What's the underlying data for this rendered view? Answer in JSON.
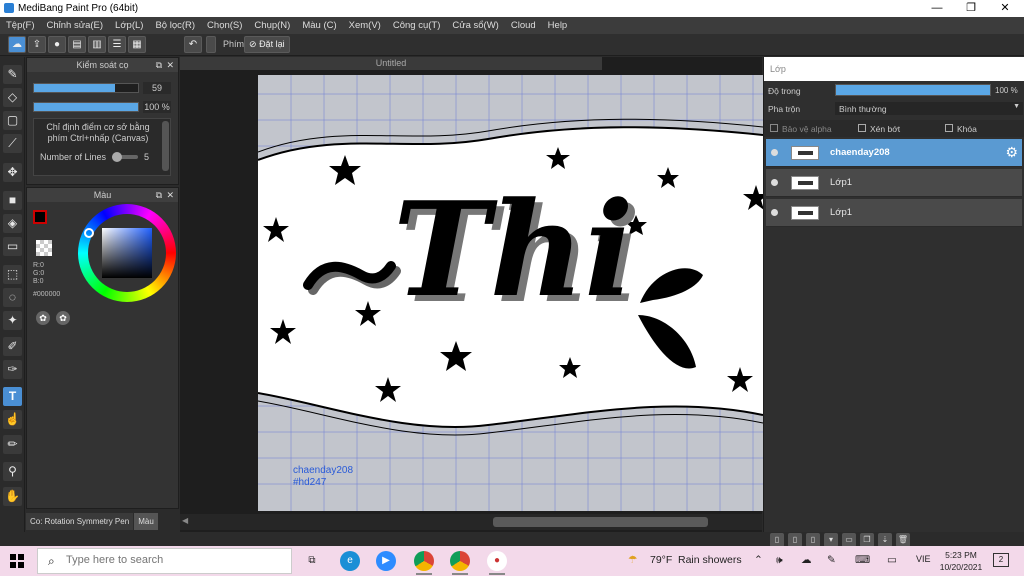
{
  "window": {
    "title": "MediBang Paint Pro (64bit)",
    "min": "—",
    "max": "❐",
    "close": "✕"
  },
  "menu": [
    "Tệp(F)",
    "Chỉnh sửa(E)",
    "Lớp(L)",
    "Bộ lọc(R)",
    "Chọn(S)",
    "Chụp(N)",
    "Màu (C)",
    "Xem(V)",
    "Công cụ(T)",
    "Cửa sổ(W)",
    "Cloud",
    "Help"
  ],
  "toolbar": {
    "phim_label": "Phím",
    "reset_label": "Đặt lại"
  },
  "brush_panel": {
    "title": "Kiểm soát cọ",
    "size_value": "59",
    "size_fraction": 0.78,
    "opacity_value": "100 %",
    "opacity_fraction": 1.0,
    "hint": "Chỉ định điểm cơ sở bằng phím Ctrl+nhấp (Canvas)",
    "lines_label": "Number of Lines",
    "lines_value": "5"
  },
  "color_panel": {
    "title": "Màu",
    "r": "R:0",
    "g": "G:0",
    "b": "B:0",
    "hex": "#000000",
    "primary": "#000000",
    "secondary": "#ffffff"
  },
  "canvas": {
    "tab": "Untitled",
    "wave_text": "Thi",
    "watermark_line1": "chaenday208",
    "watermark_line2": "#hd247"
  },
  "status": {
    "tool": "Co: Rotation Symmetry Pen",
    "tab": "Màu"
  },
  "layers_panel": {
    "title": "Lớp",
    "opacity_label": "Độ trong",
    "opacity_value": "100 %",
    "opacity_fraction": 1.0,
    "blend_label": "Pha trộn",
    "blend_value": "Bình thường",
    "protect_alpha": "Bảo vệ alpha",
    "clipping": "Xén bớt",
    "lock": "Khóa",
    "items": [
      {
        "name": "chaenday208",
        "selected": true
      },
      {
        "name": "Lớp1",
        "selected": false
      },
      {
        "name": "Lớp1",
        "selected": false
      }
    ]
  },
  "taskbar": {
    "search_placeholder": "Type here to search",
    "weather_temp": "79°F",
    "weather_text": "Rain showers",
    "lang": "VIE",
    "time": "5:23 PM",
    "date": "10/20/2021",
    "notif_count": "2"
  },
  "colors": {
    "accent": "#4a8fd4",
    "layer_selected": "#5a9ad2",
    "taskbar": "#f3d9ea"
  }
}
